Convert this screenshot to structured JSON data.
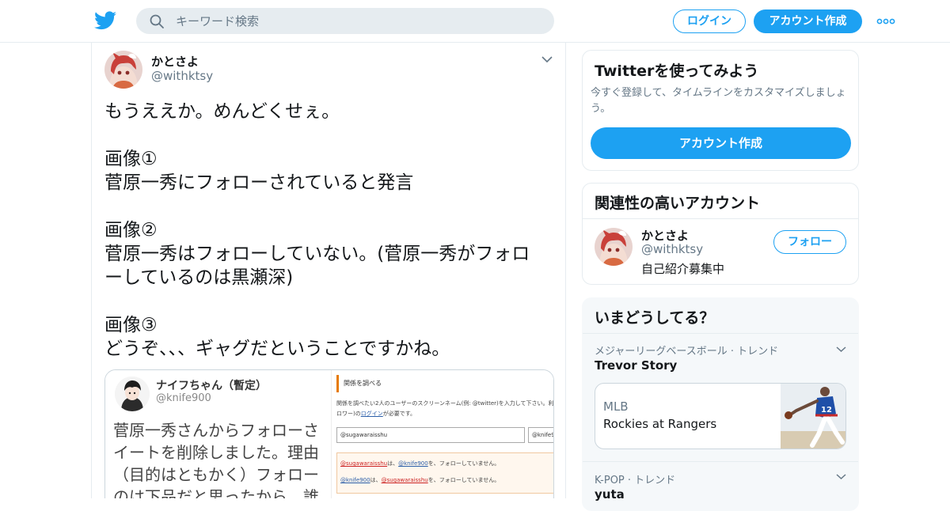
{
  "header": {
    "search_placeholder": "キーワード検索",
    "login_label": "ログイン",
    "signup_label": "アカウント作成"
  },
  "tweet": {
    "author_name": "かとさよ",
    "author_handle": "@withktsy",
    "lines": [
      "もうええか。めんどくせぇ。",
      "",
      "画像①",
      "菅原一秀にフォローされていると発言",
      "",
      "画像②",
      "菅原一秀はフォローしていない。(菅原一秀がフォロ",
      "ーしているのは黒瀬深)",
      "",
      "画像③",
      "どうぞ、、、ギャグだということですかね。"
    ],
    "media": {
      "left": {
        "name": "ナイフちゃん（暫定）",
        "handle": "@knife900",
        "body_lines": [
          "菅原一秀さんからフォローさ",
          "イートを削除しました。理由",
          "（目的はともかく）フォロー",
          "のは下品だと思ったから。誰"
        ]
      },
      "right": {
        "title": "関係を調べる",
        "desc_line1": "関係を調べたい2人のユーザーのスクリーンネーム(例: @twitter)を入力して下さい。利",
        "desc_line2_prefix": "ロワー)の",
        "desc_login": "ログイン",
        "desc_line2_suffix": "が必要です。",
        "input1": "@sugawaraisshu",
        "input2": "@knife900",
        "result1_user": "@sugawaraisshu",
        "result1_mid": "は、",
        "result1_target": "@knife900",
        "result1_end": "を、フォローしていません。",
        "result2_user": "@knife900",
        "result2_mid": "は、",
        "result2_target": "@sugawaraisshu",
        "result2_end": "を、フォローしていません。"
      }
    }
  },
  "sidebar": {
    "try_card": {
      "title": "Twitterを使ってみよう",
      "subtitle": "今すぐ登録して、タイムラインをカスタマイズしましょう。",
      "button": "アカウント作成"
    },
    "related": {
      "title": "関連性の高いアカウント",
      "name": "かとさよ",
      "handle": "@withktsy",
      "bio": "自己紹介募集中",
      "follow_label": "フォロー"
    },
    "trends": {
      "title": "いまどうしてる？",
      "items": [
        {
          "meta": "メジャーリーグベースボール · トレンド",
          "name": "Trevor Story",
          "card_source": "MLB",
          "card_title": "Rockies at Rangers"
        },
        {
          "meta": "K-POP · トレンド",
          "name": "yuta"
        }
      ]
    }
  },
  "colors": {
    "brand": "#1da1f2",
    "border": "#e6ecf0",
    "secondary_text": "#657786"
  },
  "icons": [
    "twitter-bird-icon",
    "search-icon",
    "more-dots-icon",
    "chevron-down-icon"
  ]
}
